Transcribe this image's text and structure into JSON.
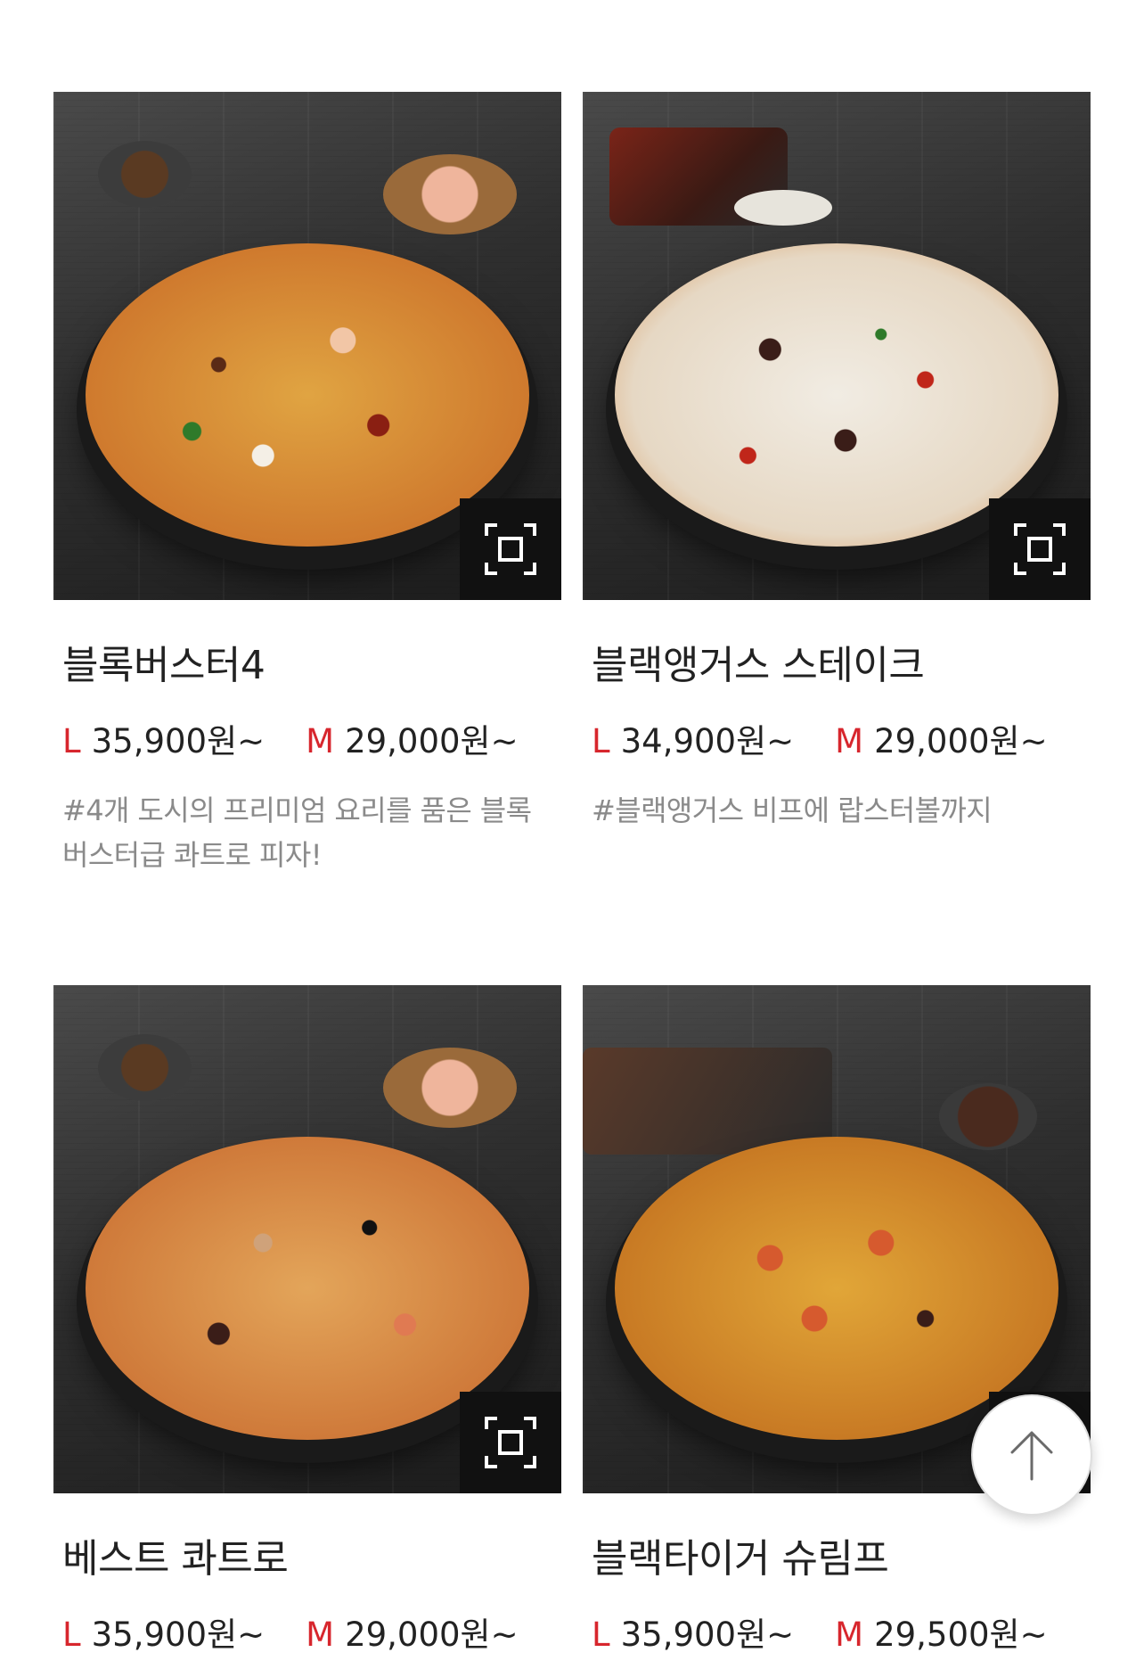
{
  "products": [
    {
      "name": "블록버스터4",
      "prices": [
        {
          "size": "L",
          "amount": "35,900원~"
        },
        {
          "size": "M",
          "amount": "29,000원~"
        }
      ],
      "description": "#4개 도시의 프리미엄 요리를 품은 블록버스터급 콰트로 피자!",
      "zoom_icon": "zoom-frame-icon"
    },
    {
      "name": "블랙앵거스 스테이크",
      "prices": [
        {
          "size": "L",
          "amount": "34,900원~"
        },
        {
          "size": "M",
          "amount": "29,000원~"
        }
      ],
      "description": "#블랙앵거스 비프에 랍스터볼까지",
      "zoom_icon": "zoom-frame-icon"
    },
    {
      "name": "베스트 콰트로",
      "prices": [
        {
          "size": "L",
          "amount": "35,900원~"
        },
        {
          "size": "M",
          "amount": "29,000원~"
        }
      ],
      "description": "",
      "zoom_icon": "zoom-frame-icon"
    },
    {
      "name": "블랙타이거 슈림프",
      "prices": [
        {
          "size": "L",
          "amount": "35,900원~"
        },
        {
          "size": "M",
          "amount": "29,500원~"
        }
      ],
      "description": "",
      "zoom_icon": "zoom-frame-icon"
    }
  ],
  "scroll_top_icon": "arrow-up-icon",
  "colors": {
    "size_label": "#d7262d",
    "description": "#8a8a8a",
    "zoom_button_bg": "#111111"
  }
}
